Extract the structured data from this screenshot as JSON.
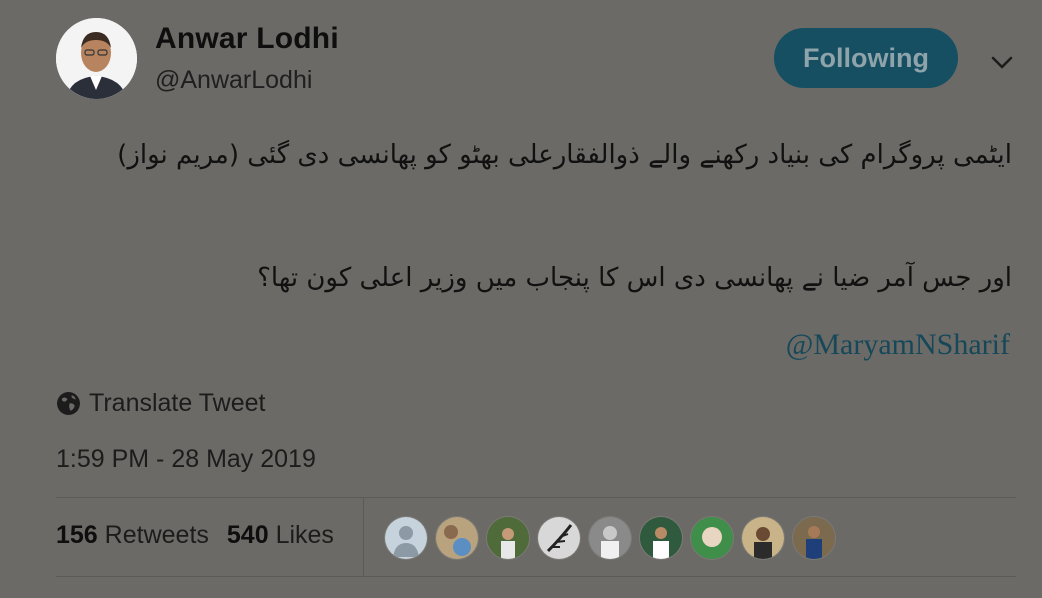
{
  "author": {
    "display_name": "Anwar Lodhi",
    "handle": "@AnwarLodhi",
    "avatar_icon": "profile-photo"
  },
  "follow_button": {
    "label": "Following",
    "color": "#154f61"
  },
  "menu_icon": "chevron-down-icon",
  "tweet": {
    "line1": "ایٹمی پروگرام کی بنیاد رکھنے والے ذوالفقارعلی بھٹو کو پھانسی دی گئی (مریم نواز)",
    "line2": "اور جس آمر ضیا نے پھانسی دی اس کا پنجاب میں وزیر اعلی کون تھا؟",
    "mention": "@MaryamNSharif"
  },
  "translate": {
    "label": "Translate Tweet",
    "icon": "globe-icon"
  },
  "timestamp": "1:59 PM - 28 May 2019",
  "stats": {
    "retweets_count": "156",
    "retweets_label": "Retweets",
    "likes_count": "540",
    "likes_label": "Likes"
  },
  "liker_avatars": [
    {
      "icon": "default-avatar-icon",
      "color": "#c7d3dc"
    },
    {
      "icon": "avatar-photo",
      "color": "#b9a27e"
    },
    {
      "icon": "avatar-photo",
      "color": "#4f6b3a"
    },
    {
      "icon": "avatar-photo",
      "color": "#d8d8d8"
    },
    {
      "icon": "avatar-photo",
      "color": "#8a8a8a"
    },
    {
      "icon": "avatar-photo",
      "color": "#2f5a3d"
    },
    {
      "icon": "avatar-photo",
      "color": "#3f8f4a"
    },
    {
      "icon": "avatar-photo",
      "color": "#c9b48a"
    },
    {
      "icon": "avatar-photo",
      "color": "#7c6a4e"
    }
  ]
}
